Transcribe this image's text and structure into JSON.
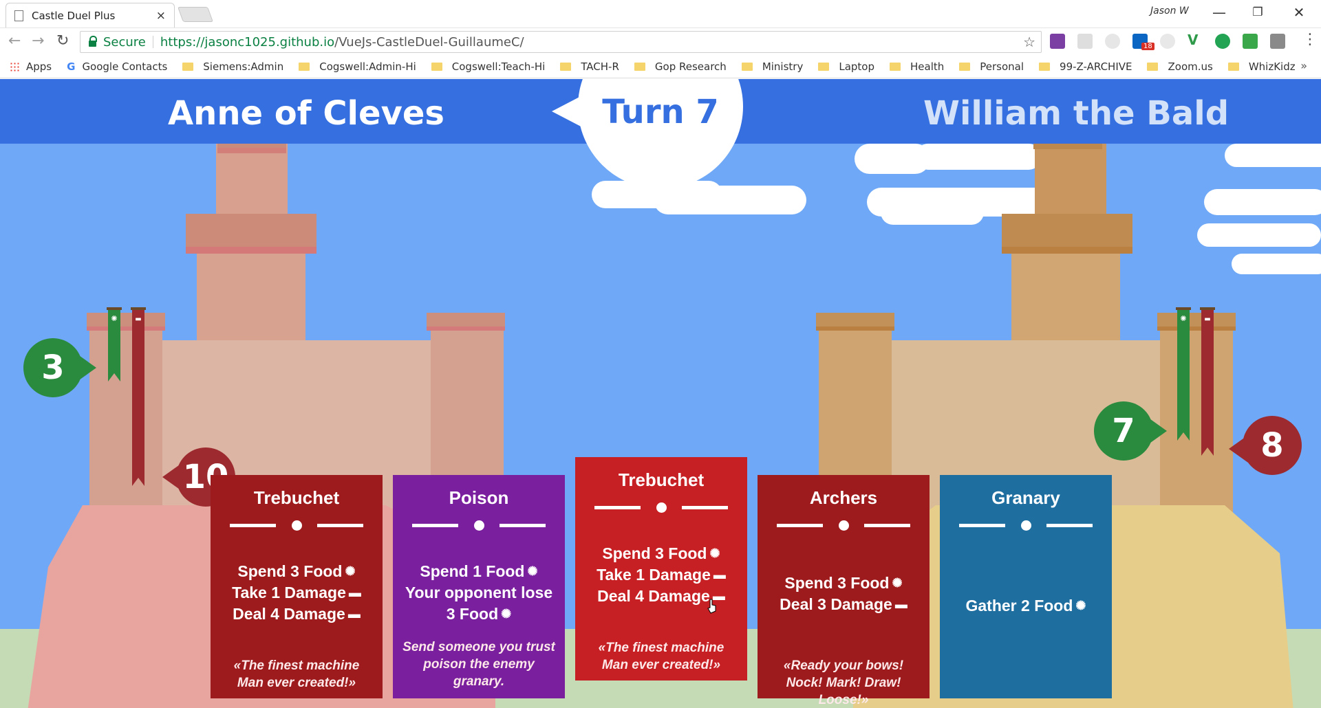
{
  "browser": {
    "tab_title": "Castle Duel Plus",
    "tab_close": "×",
    "profile": "Jason W",
    "window_buttons": {
      "minimize": "—",
      "restore": "❐",
      "close": "✕"
    },
    "nav": {
      "back": "←",
      "forward": "→",
      "reload": "↻"
    },
    "secure_label": "Secure",
    "url_host": "https://jasonc1025.github.io",
    "url_path": "/VueJs-CastleDuel-GuillaumeC/",
    "star": "☆",
    "menu": "⋮",
    "extension_badge": "18",
    "bookmarks": [
      "Apps",
      "Google Contacts",
      "Siemens:Admin",
      "Cogswell:Admin-Hi",
      "Cogswell:Teach-Hi",
      "TACH-R",
      "Gop Research",
      "Ministry",
      "Laptop",
      "Health",
      "Personal",
      "99-Z-ARCHIVE",
      "Zoom.us",
      "WhizKidz"
    ],
    "bookmarks_more": "»"
  },
  "game": {
    "player1": {
      "name": "Anne of Cleves",
      "food": 3,
      "health": 10
    },
    "player2": {
      "name": "William the Bald",
      "food": 7,
      "health": 8
    },
    "turn_label": "Turn 7",
    "colors": {
      "topbar": "#356fe0",
      "sky": "#6fa8f6",
      "food": "#2a8a3e",
      "health": "#9c2a2f"
    },
    "icons": {
      "food": "wheat-icon",
      "damage": "bricks-icon"
    },
    "food_glyph": "✺",
    "damage_glyph": "▬",
    "cards": [
      {
        "title": "Trebuchet",
        "lines": [
          "Spend 3 Food",
          "Take 1 Damage",
          "Deal 4 Damage"
        ],
        "icons": [
          "food",
          "damage",
          "damage"
        ],
        "flavor": "«The finest machine Man ever created!»",
        "color": "#9e1b1d"
      },
      {
        "title": "Poison",
        "lines": [
          "Spend 1 Food",
          "Your opponent lose",
          "3 Food"
        ],
        "icons": [
          "food",
          "",
          "food"
        ],
        "flavor": "Send someone you trust poison the enemy granary.",
        "color": "#7a1f9e"
      },
      {
        "title": "Trebuchet",
        "lines": [
          "Spend 3 Food",
          "Take 1 Damage",
          "Deal 4 Damage"
        ],
        "icons": [
          "food",
          "damage",
          "damage"
        ],
        "flavor": "«The finest machine Man ever created!»",
        "color": "#c62024",
        "selected": true
      },
      {
        "title": "Archers",
        "lines": [
          "Spend 3 Food",
          "Deal 3 Damage"
        ],
        "icons": [
          "food",
          "damage"
        ],
        "flavor": "«Ready your bows! Nock! Mark! Draw! Loose!»",
        "color": "#9e1b1d"
      },
      {
        "title": "Granary",
        "lines": [
          "Gather 2 Food"
        ],
        "icons": [
          "food"
        ],
        "flavor": "",
        "color": "#1e6ea0"
      }
    ]
  }
}
